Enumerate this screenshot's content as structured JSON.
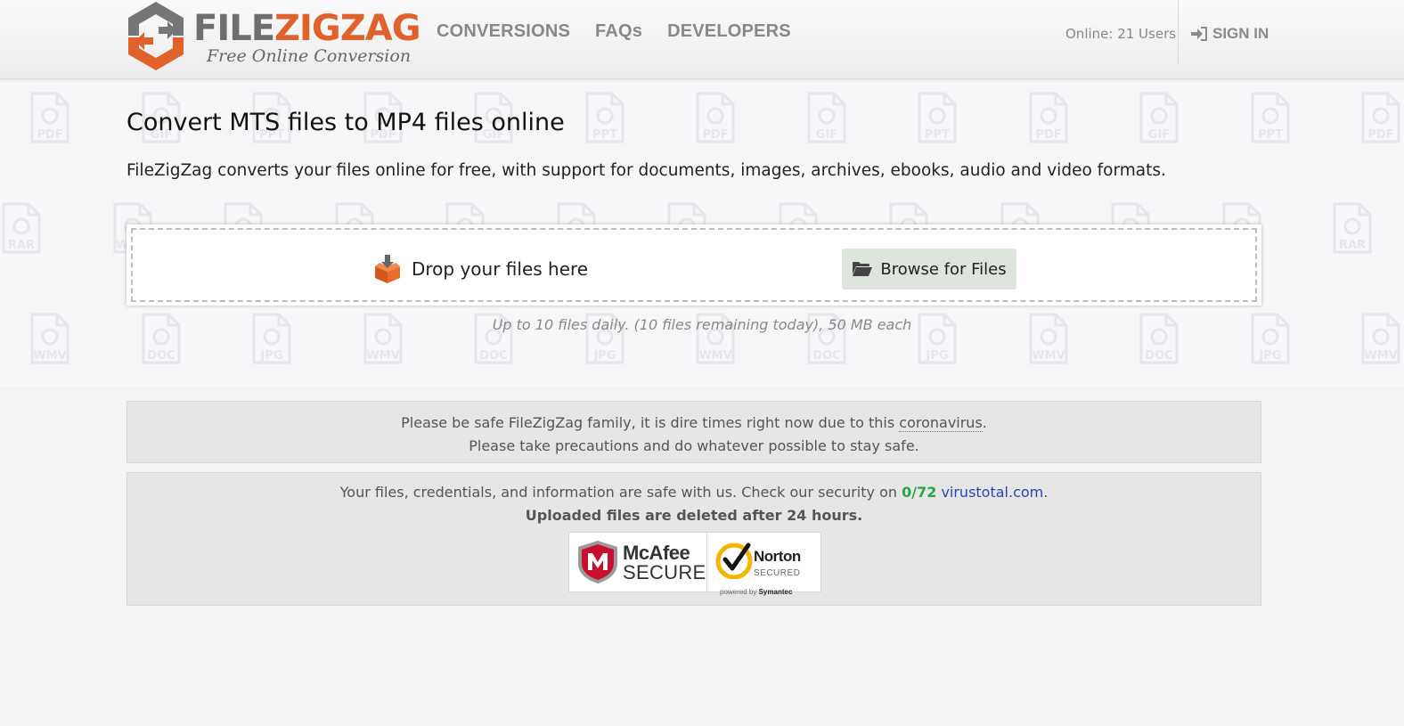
{
  "brand": {
    "name_part1": "FILE",
    "name_part2": "ZIGZAG",
    "tagline": "Free Online Conversion",
    "color_gray": "#6e6e6e",
    "color_orange": "#e0612a"
  },
  "nav": {
    "items": [
      {
        "label": "CONVERSIONS"
      },
      {
        "label": "FAQs"
      },
      {
        "label": "DEVELOPERS"
      }
    ]
  },
  "header": {
    "online_text": "Online: 21 Users",
    "signin_label": "SIGN IN"
  },
  "hero": {
    "title": "Convert MTS files to MP4 files online",
    "subtitle": "FileZigZag converts your files online for free, with support for documents, images, archives, ebooks, audio and video formats.",
    "drop_label": "Drop your files here",
    "browse_label": "Browse for Files",
    "limits": "Up to 10 files daily. (10 files remaining today), 50 MB each",
    "watermark_labels": [
      "PDF",
      "GIF",
      "PPT",
      "RAR",
      "WMV",
      "DOC",
      "JPG"
    ]
  },
  "notice": {
    "line1_prefix": "Please be safe FileZigZag family, it is dire times right now due to this ",
    "line1_link": "coronavirus",
    "line1_suffix": ".",
    "line2": "Please take precautions and do whatever possible to stay safe."
  },
  "security": {
    "line1_prefix": "Your files, credentials, and information are safe with us. Check our security on ",
    "score": "0/72",
    "link": "virustotal.com",
    "line1_suffix": ".",
    "line2": "Uploaded files are deleted after 24 hours.",
    "mcafee_line1": "McAfee",
    "mcafee_line2": "SECURE",
    "norton_line1": "Norton",
    "norton_line2": "SECURED",
    "norton_powered_prefix": "powered by ",
    "norton_powered_brand": "Symantec",
    "score_color": "#2aa44a",
    "link_color": "#2b3fbf"
  }
}
